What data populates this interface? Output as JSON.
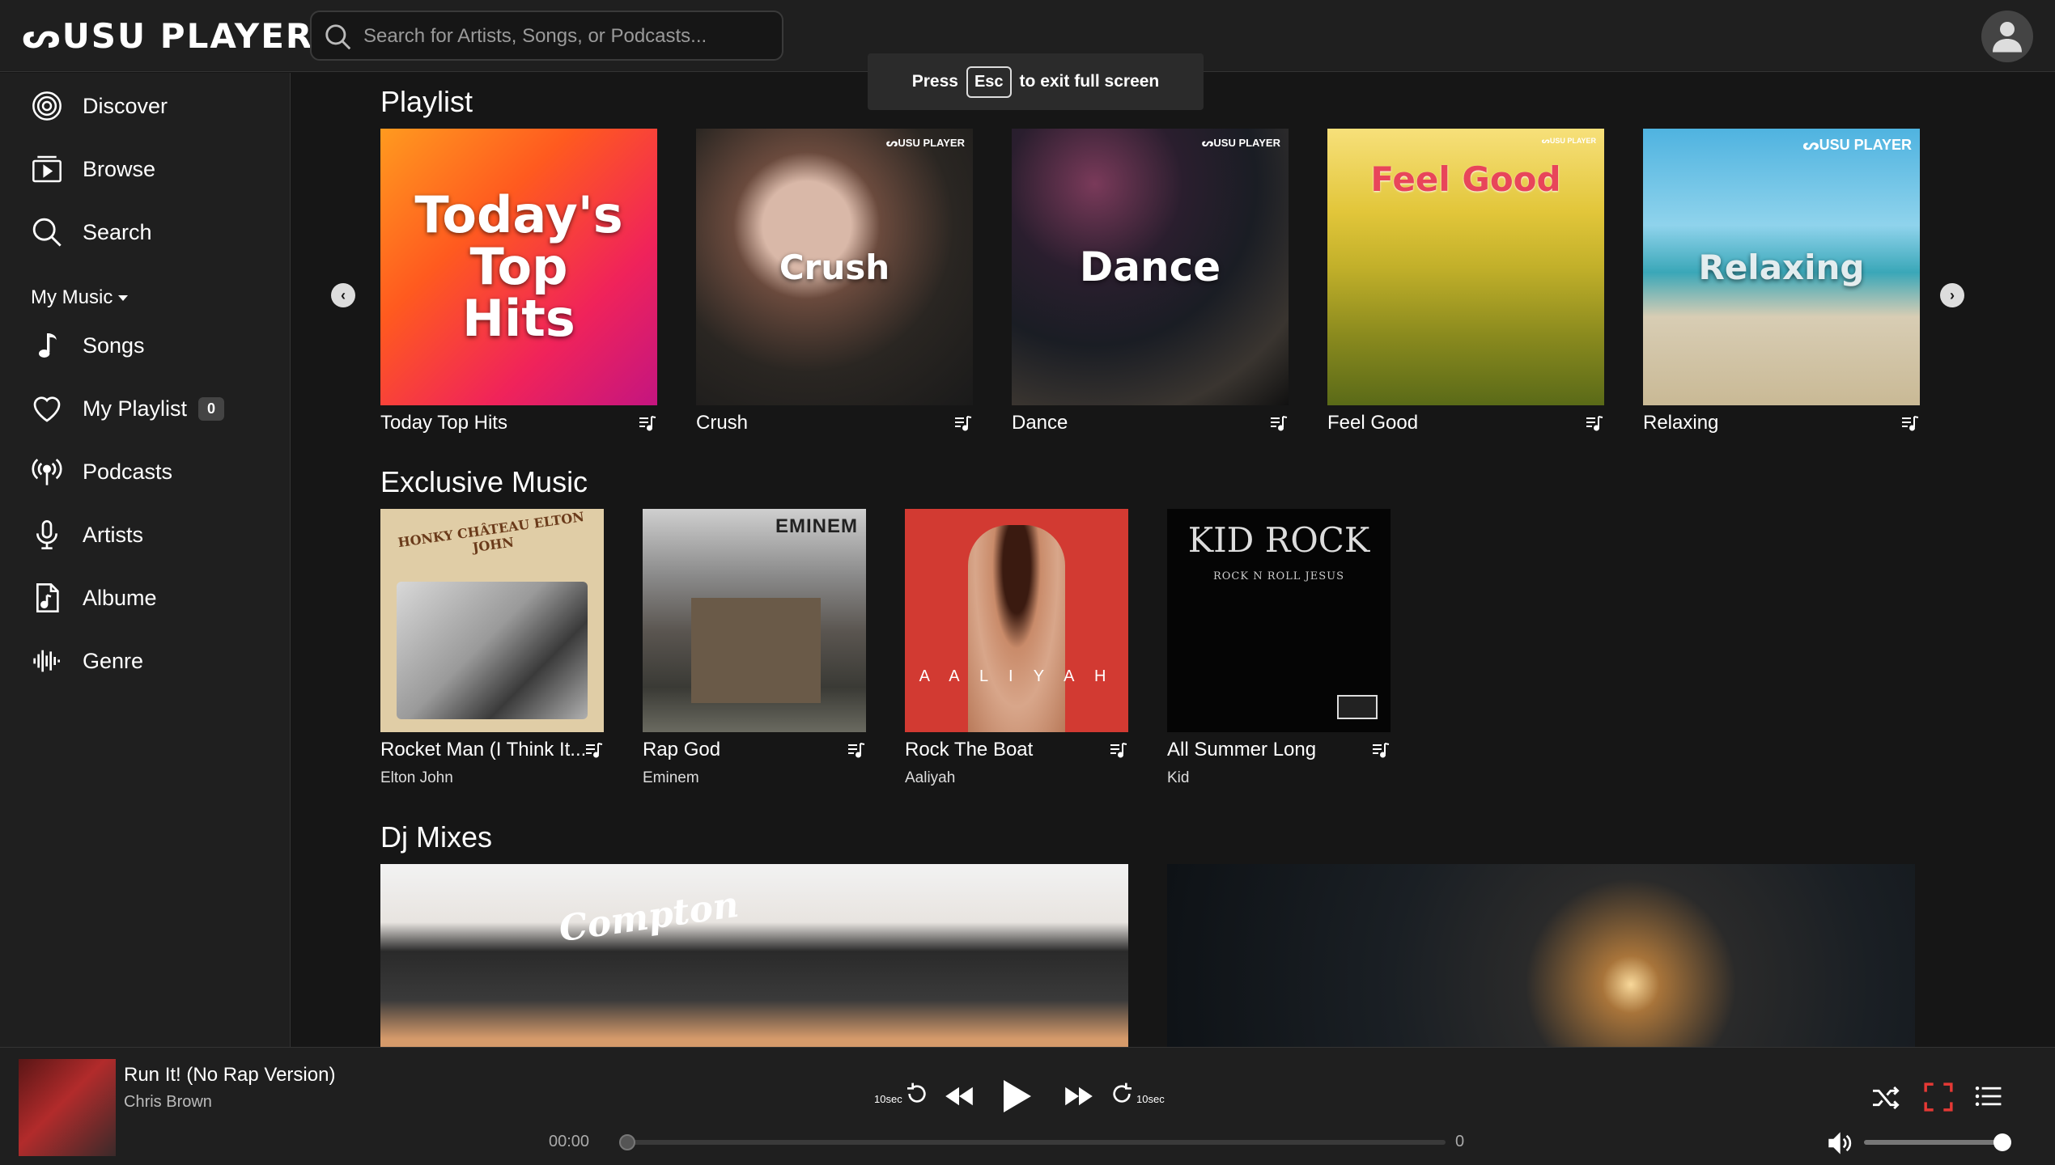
{
  "app": {
    "logo": "ᔕUSU PLAYER"
  },
  "search": {
    "placeholder": "Search for Artists, Songs, or Podcasts..."
  },
  "fullscreen_notice": {
    "press": "Press",
    "key": "Esc",
    "rest": "to exit full screen"
  },
  "sidebar": {
    "items": [
      {
        "label": "Discover",
        "icon": "disc-icon"
      },
      {
        "label": "Browse",
        "icon": "browse-icon"
      },
      {
        "label": "Search",
        "icon": "search-icon"
      }
    ],
    "my_music_label": "My Music",
    "my_music_items": [
      {
        "label": "Songs",
        "icon": "music-note-icon"
      },
      {
        "label": "My Playlist",
        "icon": "heart-icon",
        "badge": "0"
      },
      {
        "label": "Podcasts",
        "icon": "podcast-icon"
      },
      {
        "label": "Artists",
        "icon": "microphone-icon"
      },
      {
        "label": "Albume",
        "icon": "music-file-icon"
      },
      {
        "label": "Genre",
        "icon": "soundwave-icon"
      }
    ]
  },
  "playlist": {
    "title": "Playlist",
    "cards": [
      {
        "name": "Today Top Hits",
        "art_text": "Today's Top Hits",
        "watermark": ""
      },
      {
        "name": "Crush",
        "art_text": "Crush",
        "watermark": "ᔕUSU PLAYER"
      },
      {
        "name": "Dance",
        "art_text": "Dance",
        "watermark": "ᔕUSU PLAYER"
      },
      {
        "name": "Feel Good",
        "art_text": "Feel Good",
        "watermark": "ᔕUSU PLAYER"
      },
      {
        "name": "Relaxing",
        "art_text": "Relaxing",
        "watermark": "ᔕUSU PLAYER"
      }
    ]
  },
  "exclusive": {
    "title": "Exclusive Music",
    "cards": [
      {
        "title": "Rocket Man (I Think It...",
        "artist": "Elton John",
        "art_text": "HONKY CHÂTEAU ELTON JOHN"
      },
      {
        "title": "Rap God",
        "artist": "Eminem",
        "art_text": "EMINEM"
      },
      {
        "title": "Rock The Boat",
        "artist": "Aaliyah",
        "art_text": "A A L I Y A H"
      },
      {
        "title": "All Summer Long",
        "artist": "Kid",
        "art_text": "KID ROCK",
        "art_subtext": "ROCK N ROLL JESUS"
      }
    ]
  },
  "dj_mixes": {
    "title": "Dj Mixes",
    "cap_text": "Compton"
  },
  "player": {
    "track_title": "Run It! (No Rap Version)",
    "track_artist": "Chris Brown",
    "skip_back_label": "10sec",
    "skip_fwd_label": "10sec",
    "time_current": "00:00",
    "time_total": "0",
    "progress": 0,
    "volume": 1.0
  },
  "colors": {
    "bg": "#161616",
    "panel": "#1f1f1f",
    "accent_fullscreen": "#e53935"
  }
}
